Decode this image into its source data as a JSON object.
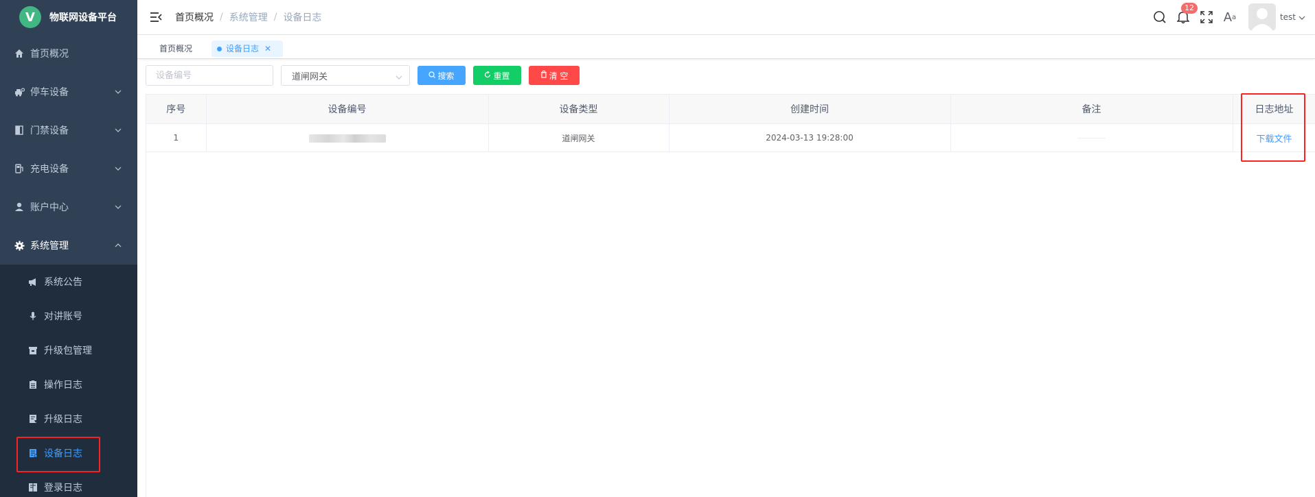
{
  "app": {
    "title": "物联网设备平台",
    "logo_letter": "V"
  },
  "sidebar": {
    "items": [
      {
        "label": "首页概况",
        "icon": "home-icon"
      },
      {
        "label": "停车设备",
        "icon": "car-icon"
      },
      {
        "label": "门禁设备",
        "icon": "door-icon"
      },
      {
        "label": "充电设备",
        "icon": "charger-icon"
      },
      {
        "label": "账户中心",
        "icon": "user-icon"
      },
      {
        "label": "系统管理",
        "icon": "gear-icon"
      }
    ],
    "sub_items": [
      {
        "label": "系统公告",
        "icon": "megaphone-icon"
      },
      {
        "label": "对讲账号",
        "icon": "microphone-icon"
      },
      {
        "label": "升级包管理",
        "icon": "package-icon"
      },
      {
        "label": "操作日志",
        "icon": "clipboard-icon"
      },
      {
        "label": "升级日志",
        "icon": "log-icon"
      },
      {
        "label": "设备日志",
        "icon": "device-log-icon"
      },
      {
        "label": "登录日志",
        "icon": "login-log-icon"
      }
    ]
  },
  "breadcrumb": [
    "首页概况",
    "系统管理",
    "设备日志"
  ],
  "header": {
    "notification_count": "12",
    "username": "test",
    "font_icon_big": "A",
    "font_icon_small": "a"
  },
  "tags": {
    "home": "首页概况",
    "current": "设备日志"
  },
  "search": {
    "device_placeholder": "设备编号",
    "type_value": "道闸网关",
    "search_label": "搜索",
    "reset_label": "重置",
    "clear_label": "清 空"
  },
  "table": {
    "columns": [
      "序号",
      "设备编号",
      "设备类型",
      "创建时间",
      "备注",
      "日志地址"
    ],
    "rows": [
      {
        "index": "1",
        "type": "道闸网关",
        "created": "2024-03-13 19:28:00",
        "link": "下载文件"
      }
    ]
  },
  "colors": {
    "sidebar_bg": "#304156",
    "submenu_bg": "#1f2d3d",
    "accent": "#409eff",
    "success": "#13ce66",
    "danger": "#ff4949",
    "highlight_box": "#ff2020"
  }
}
